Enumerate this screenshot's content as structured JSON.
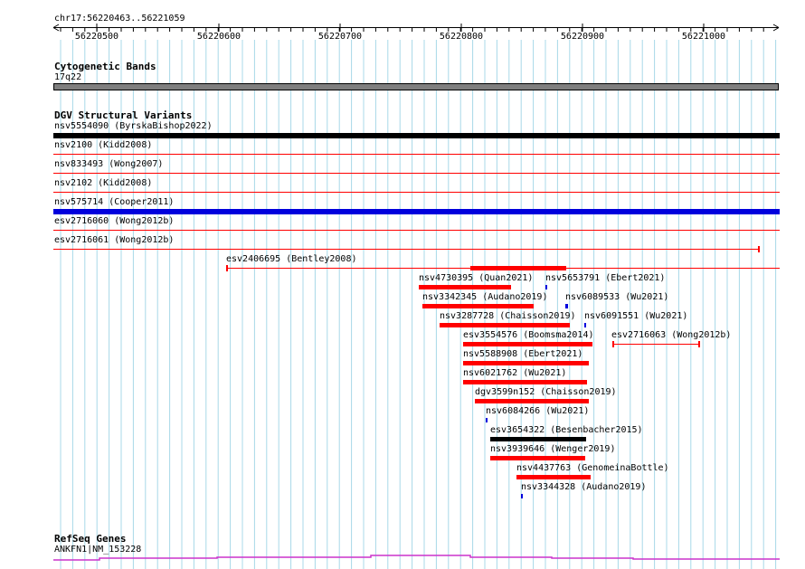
{
  "ruler": {
    "position": "chr17:56220463..56221059",
    "ticks": [
      "56220500",
      "56220600",
      "56220700",
      "56220800",
      "56220900",
      "56221000"
    ]
  },
  "cytoband": {
    "title": "Cytogenetic Bands",
    "band": "17q22"
  },
  "dgv": {
    "title": "DGV Structural Variants",
    "rows": [
      {
        "label": "nsv5554090 (ByrskaBishop2022)"
      },
      {
        "label": "nsv2100 (Kidd2008)"
      },
      {
        "label": "nsv833493 (Wong2007)"
      },
      {
        "label": "nsv2102 (Kidd2008)"
      },
      {
        "label": "nsv575714 (Cooper2011)"
      },
      {
        "label": "esv2716060 (Wong2012b)"
      },
      {
        "label": "esv2716061 (Wong2012b)"
      },
      {
        "label": "esv2406695 (Bentley2008)"
      }
    ],
    "features": [
      {
        "label": "nsv4730395 (Quan2021)"
      },
      {
        "label": "nsv5653791 (Ebert2021)"
      },
      {
        "label": "nsv3342345 (Audano2019)"
      },
      {
        "label": "nsv6089533 (Wu2021)"
      },
      {
        "label": "nsv3287728 (Chaisson2019)"
      },
      {
        "label": "nsv6091551 (Wu2021)"
      },
      {
        "label": "esv3554576 (Boomsma2014)"
      },
      {
        "label": "esv2716063 (Wong2012b)"
      },
      {
        "label": "nsv5588908 (Ebert2021)"
      },
      {
        "label": "nsv6021762 (Wu2021)"
      },
      {
        "label": "dgv3599n152 (Chaisson2019)"
      },
      {
        "label": "nsv6084266 (Wu2021)"
      },
      {
        "label": "esv3654322 (Besenbacher2015)"
      },
      {
        "label": "nsv3939646 (Wenger2019)"
      },
      {
        "label": "nsv4437763 (GenomeinaBottle)"
      },
      {
        "label": "nsv3344328 (Audano2019)"
      }
    ]
  },
  "refseq": {
    "title": "RefSeq Genes",
    "gene": "ANKFN1|NM_153228"
  },
  "colors": {
    "loss": "#ff0000",
    "gain": "#0000dd",
    "complex": "#000000",
    "gridline": "#a8d8e8",
    "band_fill": "#7f7f7f",
    "gene": "#cc33cc"
  }
}
